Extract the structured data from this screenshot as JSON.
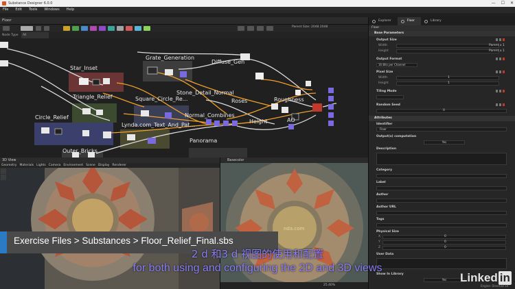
{
  "window": {
    "title": "Substance Designer 6.0.0",
    "controls": [
      "—",
      "☐",
      "✕"
    ]
  },
  "menu": [
    "File",
    "Edit",
    "Tools",
    "Windows",
    "Help"
  ],
  "graph": {
    "tab": "Floor",
    "node_type_label": "Node Type",
    "node_type_value": "All",
    "parent_size_label": "Parent Size:",
    "parent_size_w": "2048",
    "parent_size_h": "2048",
    "frames": [
      "Star_Inset",
      "Grate_Generation",
      "Diffuse_Gen",
      "Triangle_Relief",
      "Square_Circle_Re...",
      "Stone_Detail_Normal",
      "Circle_Relief",
      "Lynda.com_Text_And_Pat...",
      "Normal_Combines",
      "Roses",
      "Roughness",
      "Height",
      "AO",
      "Outer_Bricks",
      "Panorama"
    ],
    "swatches": [
      "#c9a227",
      "#4da34d",
      "#4a8ac9",
      "#b04ab0",
      "#8f4ac9",
      "#3aa59a",
      "#a3a3a3",
      "#d45b5b",
      "#5bb5d4",
      "#8ad45b"
    ]
  },
  "view3d": {
    "title": "3D View",
    "menu": [
      "Geometry",
      "Materials",
      "Lights",
      "Camera",
      "Environment",
      "Scene",
      "Display",
      "Renderer"
    ]
  },
  "view2d": {
    "title": "Basecolor",
    "zoom": "25.40%"
  },
  "properties": {
    "tabs": [
      "Explorer",
      "Floor",
      "Library"
    ],
    "title": "Floor",
    "base_params": "Base Parameters",
    "output_size": "Output Size",
    "width": "Width",
    "height": "Height",
    "parent_x1": "Parent x 1",
    "output_format": "Output Format",
    "format_value": "16 Bits per Channel",
    "pixel_size": "Pixel Size",
    "one": "1",
    "tiling_mode": "Tiling Mode",
    "random_seed": "Random Seed",
    "zero": "0",
    "attributes": "Attributes",
    "identifier": "Identifier",
    "identifier_value": "Floor",
    "outputs_computation": "Output(s) computation",
    "yes": "Yes",
    "description": "Description",
    "category": "Category",
    "label": "Label",
    "author": "Author",
    "author_url": "Author URL",
    "tags": "Tags",
    "physical_size": "Physical Size",
    "x": "X",
    "y": "Y",
    "z": "Z",
    "user_data": "User Data",
    "show_in_library": "Show In Library"
  },
  "overlay": {
    "breadcrumb": "Exercise Files > Substances > Floor_Relief_Final.sbs",
    "subtitle_cn": "2 d 和3 d 视图的使用和配置",
    "subtitle_en": "for both using and configuring the 2D and 3D views",
    "brand": "Linked",
    "brand_in": "in",
    "engine": "Engine: Direct3D 10"
  },
  "colors": {
    "accent_blue": "#2a7bc4",
    "subtitle": "#8a7ff5",
    "wire_orange": "#f0a02a",
    "wire_white": "#dcdcdc",
    "node_purple": "#7a6ae0"
  }
}
